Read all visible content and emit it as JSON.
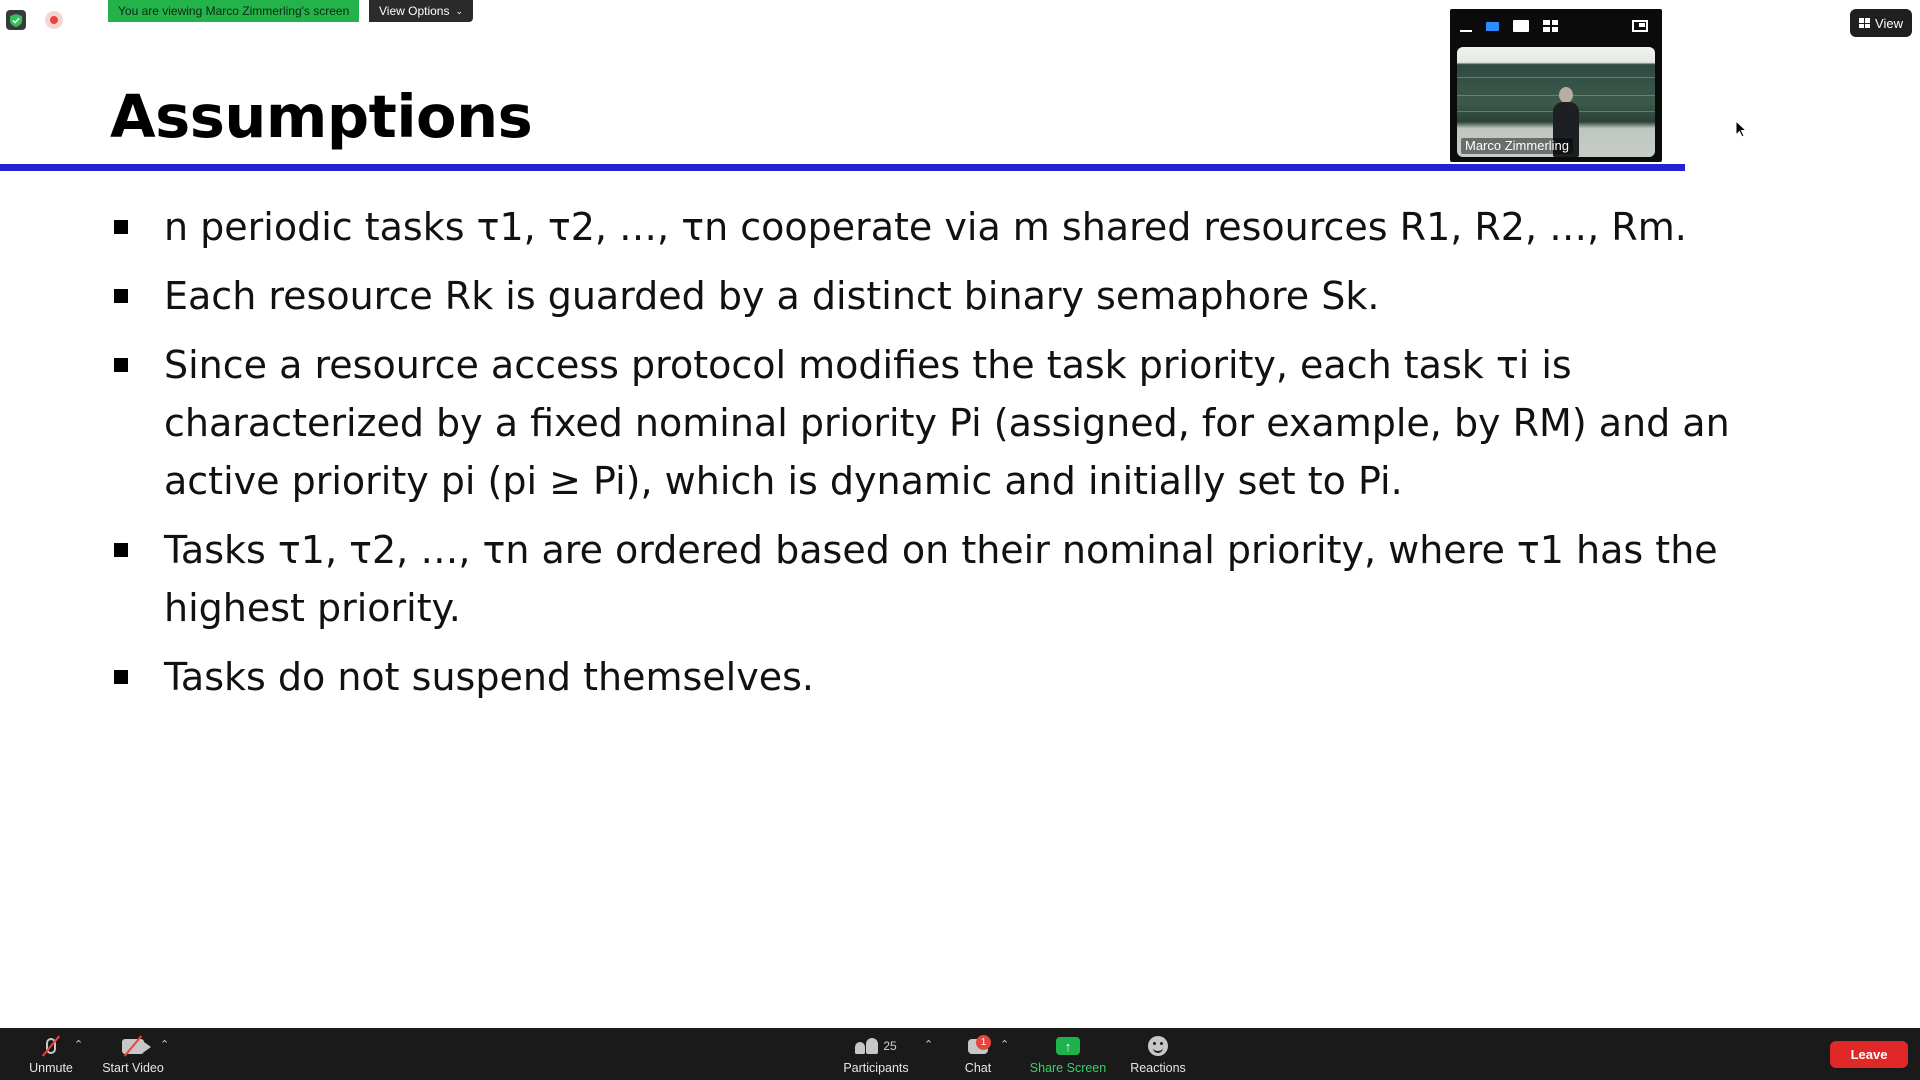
{
  "overlay": {
    "viewing_banner": "You are viewing Marco Zimmerling's screen",
    "view_options_label": "View Options",
    "view_button_label": "View"
  },
  "video": {
    "participant_name": "Marco Zimmerling"
  },
  "slide": {
    "title": "Assumptions",
    "bullets": [
      "n periodic tasks τ1, τ2, …, τn cooperate via m shared resources R1, R2, …, Rm.",
      "Each resource Rk is guarded by a distinct binary semaphore Sk.",
      "Since a resource access protocol modifies the task priority, each task τi is characterized by a fixed nominal priority Pi (assigned, for example, by RM) and an active priority pi (pi ≥ Pi), which is dynamic and initially set to Pi.",
      "Tasks τ1, τ2, …, τn are ordered based on their nominal priority, where τ1 has the highest priority.",
      "Tasks do not suspend themselves."
    ],
    "accent_color": "#2323d3",
    "emphasis_color": "#2b2bcf"
  },
  "toolbar": {
    "unmute_label": "Unmute",
    "start_video_label": "Start Video",
    "participants_label": "Participants",
    "participants_count": "25",
    "chat_label": "Chat",
    "chat_badge": "1",
    "share_screen_label": "Share Screen",
    "reactions_label": "Reactions",
    "leave_label": "Leave"
  },
  "colors": {
    "banner_green": "#24b24b",
    "leave_red": "#e02828",
    "toolbar_bg": "#1a1a1a"
  }
}
